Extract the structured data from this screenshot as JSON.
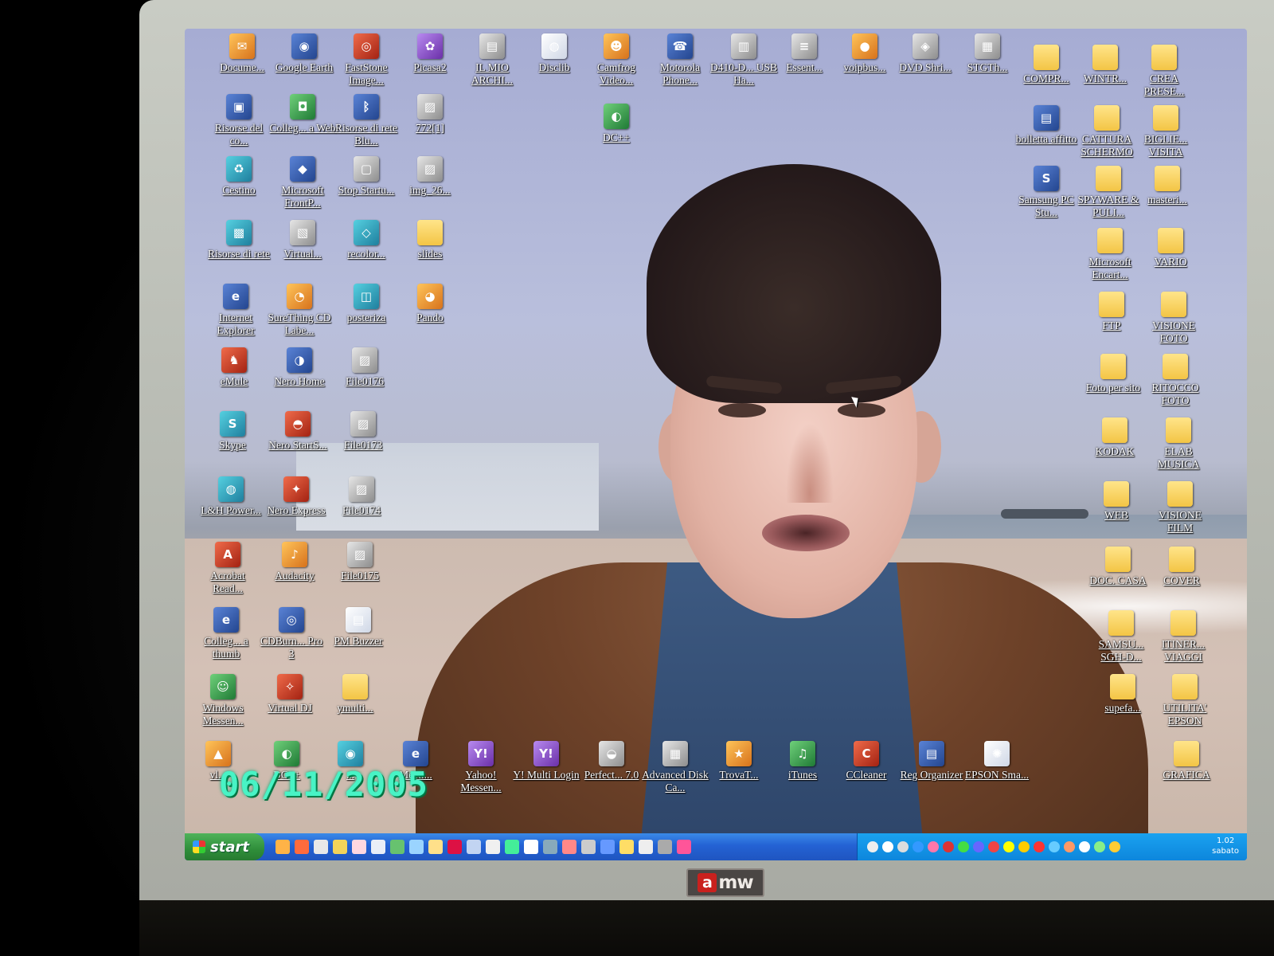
{
  "desktop": {
    "left_icons": [
      {
        "label": "Docume...",
        "glyph": "✉",
        "kind": "g-orange"
      },
      {
        "label": "Google Earth",
        "glyph": "◉",
        "kind": "g-app"
      },
      {
        "label": "FastStone Image...",
        "glyph": "◎",
        "kind": "g-red"
      },
      {
        "label": "Picasa2",
        "glyph": "✿",
        "kind": "g-purple"
      },
      {
        "label": "IL MIO ARCHI...",
        "glyph": "▤",
        "kind": "g-file"
      },
      {
        "label": "Disclib",
        "glyph": "◍",
        "kind": "g-doc"
      },
      {
        "label": "Camfrog Video...",
        "glyph": "☻",
        "kind": "g-orange"
      },
      {
        "label": "Motorola Phone...",
        "glyph": "☎",
        "kind": "g-app"
      },
      {
        "label": "D410-D... USB Ha...",
        "glyph": "▥",
        "kind": "g-file"
      },
      {
        "label": "Essent...",
        "glyph": "≡",
        "kind": "g-file"
      },
      {
        "label": "voipbus...",
        "glyph": "●",
        "kind": "g-orange"
      },
      {
        "label": "DVD Shri...",
        "glyph": "◈",
        "kind": "g-file"
      },
      {
        "label": "STGTh...",
        "glyph": "▦",
        "kind": "g-file"
      },
      {
        "label": "Risorse del co...",
        "glyph": "▣",
        "kind": "g-app"
      },
      {
        "label": "Colleg... a Web",
        "glyph": "◘",
        "kind": "g-green"
      },
      {
        "label": "Risorse di rete Blu...",
        "glyph": "ᛒ",
        "kind": "g-app"
      },
      {
        "label": "772[1]",
        "glyph": "▨",
        "kind": "g-file"
      },
      {
        "label": "DC++",
        "glyph": "◐",
        "kind": "g-green"
      },
      {
        "label": "Cestino",
        "glyph": "♻",
        "kind": "g-teal"
      },
      {
        "label": "Microsoft FrontP...",
        "glyph": "◆",
        "kind": "g-app"
      },
      {
        "label": "Stop Startu...",
        "glyph": "▢",
        "kind": "g-file"
      },
      {
        "label": "img_26...",
        "glyph": "▨",
        "kind": "g-file"
      },
      {
        "label": "Risorse di rete",
        "glyph": "▩",
        "kind": "g-teal"
      },
      {
        "label": "Virtual...",
        "glyph": "▧",
        "kind": "g-file"
      },
      {
        "label": "recolor...",
        "glyph": "◇",
        "kind": "g-teal"
      },
      {
        "label": "slides",
        "glyph": "",
        "kind": "g-folder"
      },
      {
        "label": "Internet Explorer",
        "glyph": "e",
        "kind": "g-app"
      },
      {
        "label": "SureThing CD Labe...",
        "glyph": "◔",
        "kind": "g-orange"
      },
      {
        "label": "posteriza",
        "glyph": "◫",
        "kind": "g-teal"
      },
      {
        "label": "Pando",
        "glyph": "◕",
        "kind": "g-orange"
      },
      {
        "label": "eMule",
        "glyph": "♞",
        "kind": "g-red"
      },
      {
        "label": "Nero Home",
        "glyph": "◑",
        "kind": "g-app"
      },
      {
        "label": "File0176",
        "glyph": "▨",
        "kind": "g-file"
      },
      {
        "label": "Skype",
        "glyph": "S",
        "kind": "g-teal"
      },
      {
        "label": "Nero StartS...",
        "glyph": "◓",
        "kind": "g-red"
      },
      {
        "label": "File0173",
        "glyph": "▨",
        "kind": "g-file"
      },
      {
        "label": "L&H Power...",
        "glyph": "◍",
        "kind": "g-teal"
      },
      {
        "label": "Nero Express",
        "glyph": "✦",
        "kind": "g-red"
      },
      {
        "label": "File0174",
        "glyph": "▨",
        "kind": "g-file"
      },
      {
        "label": "Acrobat Read...",
        "glyph": "A",
        "kind": "g-red"
      },
      {
        "label": "Audacity",
        "glyph": "♪",
        "kind": "g-orange"
      },
      {
        "label": "File0175",
        "glyph": "▨",
        "kind": "g-file"
      },
      {
        "label": "Colleg... a thumb",
        "glyph": "e",
        "kind": "g-app"
      },
      {
        "label": "CDBurn... Pro 3",
        "glyph": "◎",
        "kind": "g-app"
      },
      {
        "label": "PM Buzzer",
        "glyph": "▤",
        "kind": "g-doc"
      },
      {
        "label": "Windows Messen...",
        "glyph": "☺",
        "kind": "g-green"
      },
      {
        "label": "Virtual DJ",
        "glyph": "✧",
        "kind": "g-red"
      },
      {
        "label": "ymulti...",
        "glyph": "",
        "kind": "g-folder"
      },
      {
        "label": "vl...",
        "glyph": "▲",
        "kind": "g-orange"
      },
      {
        "label": "DC++",
        "glyph": "◐",
        "kind": "g-green"
      },
      {
        "label": "...",
        "glyph": "◉",
        "kind": "g-teal"
      },
      {
        "label": "Meeti...",
        "glyph": "e",
        "kind": "g-app"
      },
      {
        "label": "Yahoo! Messen...",
        "glyph": "Y!",
        "kind": "g-purple"
      },
      {
        "label": "Y! Multi Login",
        "glyph": "Y!",
        "kind": "g-purple"
      },
      {
        "label": "Perfect... 7.0",
        "glyph": "◒",
        "kind": "g-file"
      },
      {
        "label": "Advanced Disk Ca...",
        "glyph": "▦",
        "kind": "g-file"
      },
      {
        "label": "TrovaT...",
        "glyph": "★",
        "kind": "g-orange"
      },
      {
        "label": "iTunes",
        "glyph": "♫",
        "kind": "g-green"
      },
      {
        "label": "CCleaner",
        "glyph": "C",
        "kind": "g-red"
      },
      {
        "label": "Reg Organizer",
        "glyph": "▤",
        "kind": "g-app"
      },
      {
        "label": "EPSON Sma...",
        "glyph": "✺",
        "kind": "g-doc"
      }
    ],
    "right_icons": [
      {
        "label": "COMPR...",
        "glyph": ""
      },
      {
        "label": "WINTR...",
        "glyph": ""
      },
      {
        "label": "CREA PRESE...",
        "glyph": ""
      },
      {
        "label": "bolletta affitto",
        "glyph": "▤"
      },
      {
        "label": "CATTURA SCHERMO",
        "glyph": ""
      },
      {
        "label": "BIGLIE... VISITA",
        "glyph": ""
      },
      {
        "label": "Samsung PC Stu...",
        "glyph": "S"
      },
      {
        "label": "SPYWARE & PULI...",
        "glyph": ""
      },
      {
        "label": "masteri...",
        "glyph": ""
      },
      {
        "label": "Microsoft Encart...",
        "glyph": ""
      },
      {
        "label": "VARIO",
        "glyph": ""
      },
      {
        "label": "FTP",
        "glyph": ""
      },
      {
        "label": "VISIONE FOTO",
        "glyph": ""
      },
      {
        "label": "Foto per sito",
        "glyph": ""
      },
      {
        "label": "RITOCCO FOTO",
        "glyph": ""
      },
      {
        "label": "KODAK",
        "glyph": ""
      },
      {
        "label": "ELAB MUSICA",
        "glyph": ""
      },
      {
        "label": "WEB",
        "glyph": ""
      },
      {
        "label": "VISIONE FILM",
        "glyph": ""
      },
      {
        "label": "DOC. CASA",
        "glyph": ""
      },
      {
        "label": "COVER",
        "glyph": ""
      },
      {
        "label": "SAMSU... SGH-D...",
        "glyph": ""
      },
      {
        "label": "ITINER... VIAGGI",
        "glyph": ""
      },
      {
        "label": "supefa...",
        "glyph": ""
      },
      {
        "label": "UTILITA' EPSON",
        "glyph": ""
      },
      {
        "label": "GRAFICA",
        "glyph": ""
      }
    ]
  },
  "taskbar": {
    "start_label": "start",
    "clock_time": "1.02",
    "clock_day": "sabato"
  },
  "photo": {
    "date_stamp": "06/11/2005",
    "monitor_brand_a": "a",
    "monitor_brand_rest": "mw"
  }
}
